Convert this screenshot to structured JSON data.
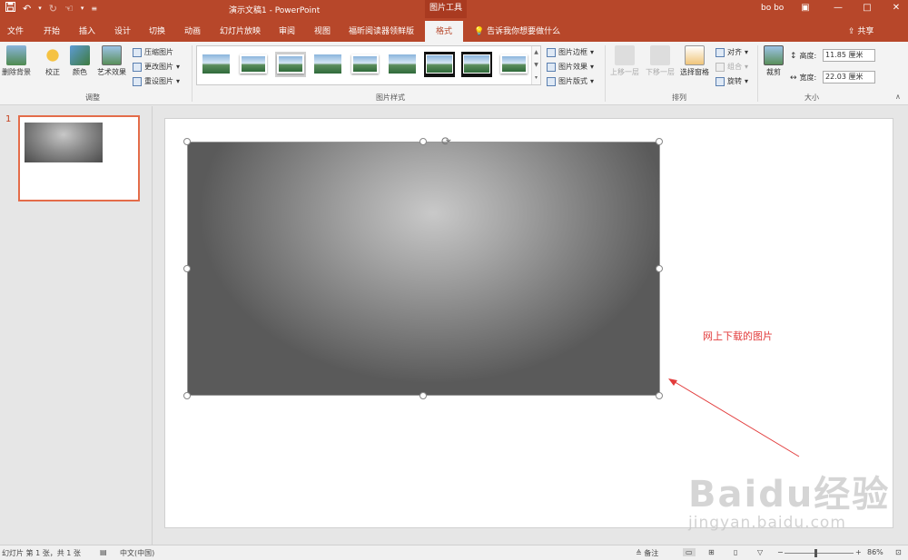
{
  "titlebar": {
    "doc_title": "演示文稿1  -  PowerPoint",
    "context_tool": "图片工具",
    "user": "bo bo",
    "qat_icons": [
      "save-icon",
      "undo-icon",
      "redo-icon",
      "touch-mode-icon",
      "customize-icon"
    ]
  },
  "tabs": [
    "文件",
    "开始",
    "插入",
    "设计",
    "切换",
    "动画",
    "幻灯片放映",
    "审阅",
    "视图",
    "福昕阅读器领鲜版",
    "格式"
  ],
  "active_tab": "格式",
  "tellme": "告诉我你想要做什么",
  "share": "共享",
  "ribbon": {
    "adjust": {
      "remove_bg": "删除背景",
      "corrections": "校正",
      "color": "颜色",
      "artistic": "艺术效果",
      "compress": "压缩图片",
      "change": "更改图片",
      "reset": "重设图片",
      "label": "调整"
    },
    "styles": {
      "label": "图片样式",
      "border": "图片边框",
      "effects": "图片效果",
      "layout": "图片版式"
    },
    "arrange": {
      "label": "排列",
      "bring_forward": "上移一层",
      "send_backward": "下移一层",
      "selection_pane": "选择窗格",
      "align": "对齐",
      "group": "组合",
      "rotate": "旋转"
    },
    "size": {
      "label": "大小",
      "crop": "裁剪",
      "height_label": "高度:",
      "height_value": "11.85 厘米",
      "width_label": "宽度:",
      "width_value": "22.03 厘米"
    }
  },
  "slides_pane": {
    "slide_number": "1"
  },
  "slide": {
    "annotation": "网上下载的图片",
    "annotation_color": "#e23b3b"
  },
  "watermark": {
    "brand": "Baidu经验",
    "url": "jingyan.baidu.com"
  },
  "statusbar": {
    "slide_info": "幻灯片 第 1 张，共 1 张",
    "language": "中文(中国)",
    "notes": "备注",
    "zoom": "86%"
  },
  "colors": {
    "accent": "#b7472a"
  }
}
